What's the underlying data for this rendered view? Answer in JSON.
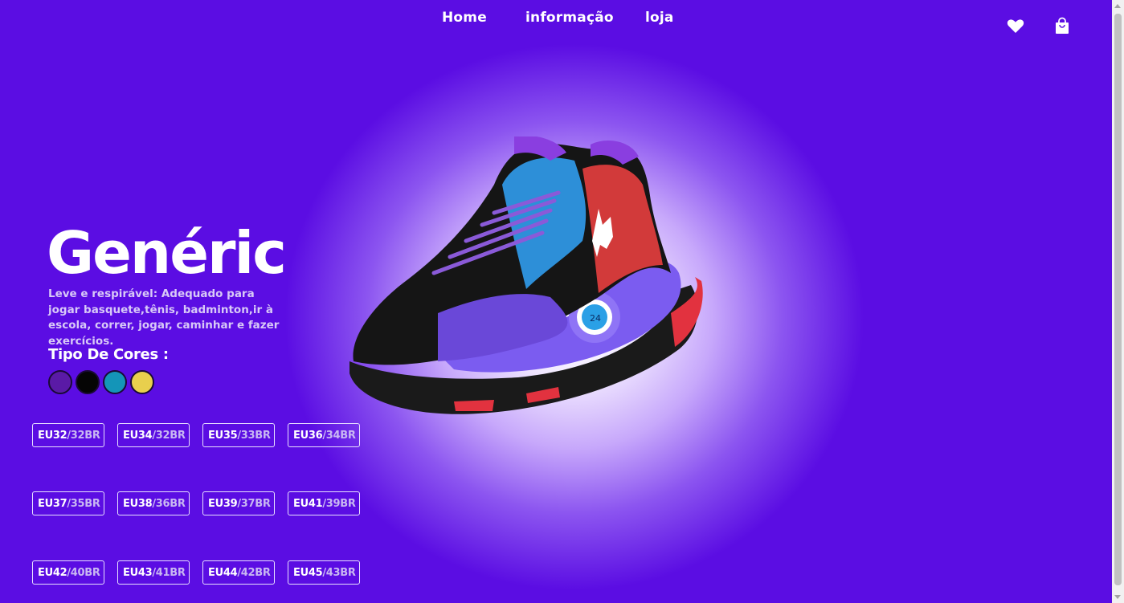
{
  "nav": {
    "items": [
      "Home",
      "informação",
      "loja"
    ]
  },
  "icons": {
    "wishlist": "heart-icon",
    "cart": "shopping-bag-icon"
  },
  "product": {
    "name": "Genéric",
    "description": "Leve e respirável: Adequado para jogar basquete,tênis, badminton,ir à escola, correr, jogar, caminhar e fazer exercícios.",
    "colors_label": "Tipo De Cores :",
    "colors": [
      "#5a1aa6",
      "#050505",
      "#1495b8",
      "#e8cf4d"
    ]
  },
  "sizes": [
    {
      "eu": "EU32",
      "br": "/32BR"
    },
    {
      "eu": "EU34",
      "br": "/32BR"
    },
    {
      "eu": "EU35",
      "br": "/33BR"
    },
    {
      "eu": "EU36",
      "br": "/34BR"
    },
    {
      "eu": "EU37",
      "br": "/35BR"
    },
    {
      "eu": "EU38",
      "br": "/36BR"
    },
    {
      "eu": "EU39",
      "br": "/37BR"
    },
    {
      "eu": "EU41",
      "br": "/39BR"
    },
    {
      "eu": "EU42",
      "br": "/40BR"
    },
    {
      "eu": "EU43",
      "br": "/41BR"
    },
    {
      "eu": "EU44",
      "br": "/42BR"
    },
    {
      "eu": "EU45",
      "br": "/43BR"
    }
  ],
  "theme": {
    "background": "#5b0de3"
  }
}
